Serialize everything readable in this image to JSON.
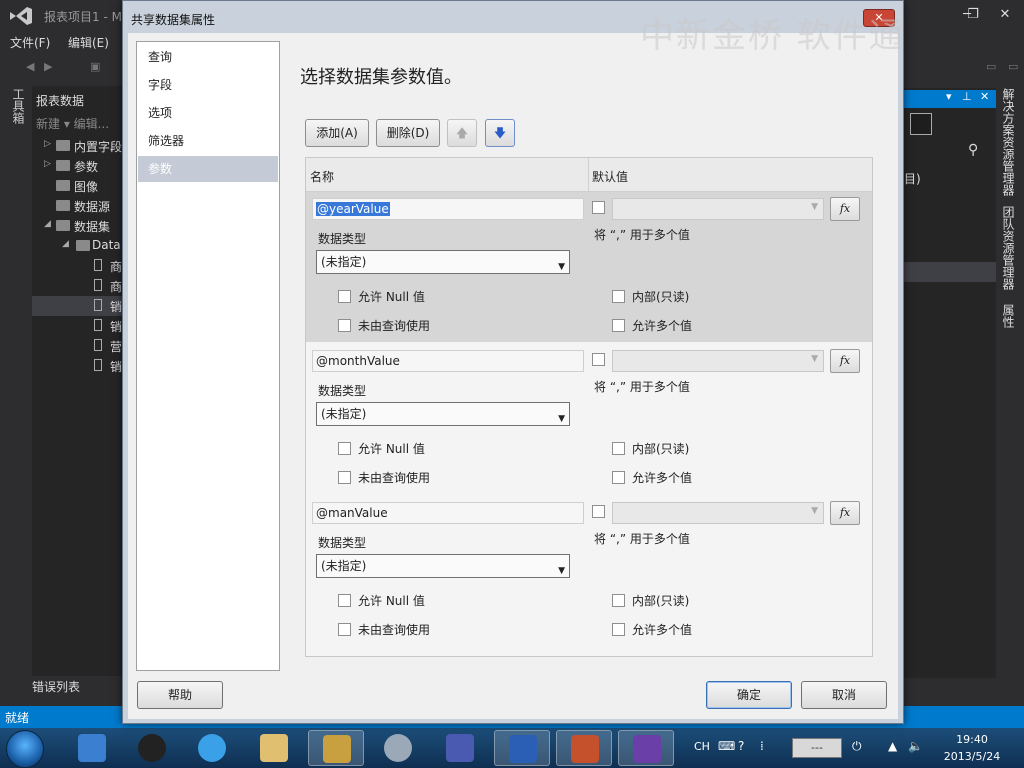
{
  "vs": {
    "title": "报表项目1 - M",
    "menu": [
      "文件(F)",
      "编辑(E)"
    ],
    "left_tab": "工具箱",
    "panel_title": "报表数据",
    "panel_new": "新建 ▾  编辑...",
    "tree": [
      {
        "label": "内置字段",
        "kind": "folder",
        "arrow": "▷"
      },
      {
        "label": "参数",
        "kind": "folder",
        "arrow": "▷"
      },
      {
        "label": "图像",
        "kind": "folder",
        "arrow": ""
      },
      {
        "label": "数据源",
        "kind": "folder",
        "arrow": ""
      },
      {
        "label": "数据集",
        "kind": "folder",
        "arrow": "◢"
      },
      {
        "label": "Data",
        "kind": "db",
        "arrow": "◢"
      },
      {
        "label": "商",
        "kind": "doc",
        "arrow": ""
      },
      {
        "label": "商",
        "kind": "doc",
        "arrow": ""
      },
      {
        "label": "销",
        "kind": "doc",
        "arrow": "",
        "selected": true
      },
      {
        "label": "销",
        "kind": "doc",
        "arrow": ""
      },
      {
        "label": "营",
        "kind": "doc",
        "arrow": ""
      },
      {
        "label": "销",
        "kind": "doc",
        "arrow": ""
      }
    ],
    "error_list": "错误列表",
    "status": "就绪",
    "right_side_labels": [
      "解决方案资源管理器",
      "团队资源管理器",
      "属性"
    ],
    "right_text": "目)"
  },
  "watermark": "中新金桥 软件通",
  "dialog": {
    "title": "共享数据集属性",
    "nav": [
      {
        "label": "查询",
        "selected": false
      },
      {
        "label": "字段",
        "selected": false
      },
      {
        "label": "选项",
        "selected": false
      },
      {
        "label": "筛选器",
        "selected": false
      },
      {
        "label": "参数",
        "selected": true
      }
    ],
    "heading": "选择数据集参数值。",
    "toolbar": {
      "add": "添加(A)",
      "delete": "删除(D)",
      "up": "🡅",
      "down": "🡇"
    },
    "grid": {
      "col_name": "名称",
      "col_default": "默认值",
      "params": [
        {
          "name": "@yearValue",
          "data_type_label": "数据类型",
          "data_type": "(未指定)",
          "multi_note": "将 “,” 用于多个值",
          "allow_null": "允许 Null 值",
          "internal": "内部(只读)",
          "not_query": "未由查询使用",
          "allow_multi": "允许多个值",
          "selected": true
        },
        {
          "name": "@monthValue",
          "data_type_label": "数据类型",
          "data_type": "(未指定)",
          "multi_note": "将 “,” 用于多个值",
          "allow_null": "允许 Null 值",
          "internal": "内部(只读)",
          "not_query": "未由查询使用",
          "allow_multi": "允许多个值",
          "selected": false
        },
        {
          "name": "@manValue",
          "data_type_label": "数据类型",
          "data_type": "(未指定)",
          "multi_note": "将 “,” 用于多个值",
          "allow_null": "允许 Null 值",
          "internal": "内部(只读)",
          "not_query": "未由查询使用",
          "allow_multi": "允许多个值",
          "selected": false
        }
      ],
      "fx": "fx"
    },
    "buttons": {
      "help": "帮助",
      "ok": "确定",
      "cancel": "取消"
    }
  },
  "taskbar": {
    "lang": "CH",
    "tray_box": "---",
    "time": "19:40",
    "date": "2013/5/24"
  }
}
